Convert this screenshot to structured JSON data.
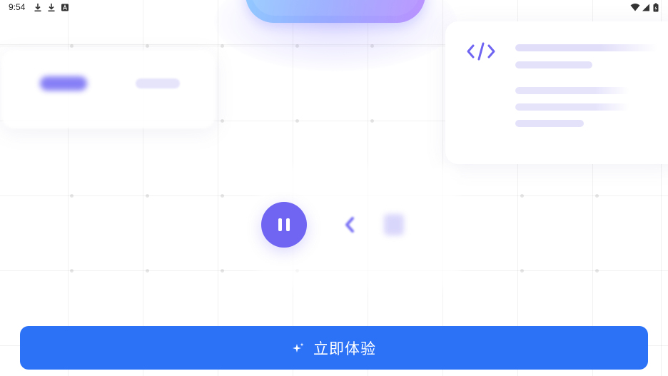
{
  "status_bar": {
    "time": "9:54",
    "left_icons": [
      "download-icon",
      "download-icon",
      "notification-a-icon"
    ],
    "right_icons": [
      "wifi-icon",
      "signal-icon",
      "battery-icon"
    ]
  },
  "code_card": {
    "icon": "code-icon",
    "accent": "#6f65f2"
  },
  "player": {
    "pause_icon": "pause-icon",
    "prev_icon": "chevron-left-icon",
    "accent": "#6f65f2"
  },
  "cta": {
    "label": "立即体验",
    "icon": "sparkle-icon",
    "color": "#2c72f7"
  }
}
